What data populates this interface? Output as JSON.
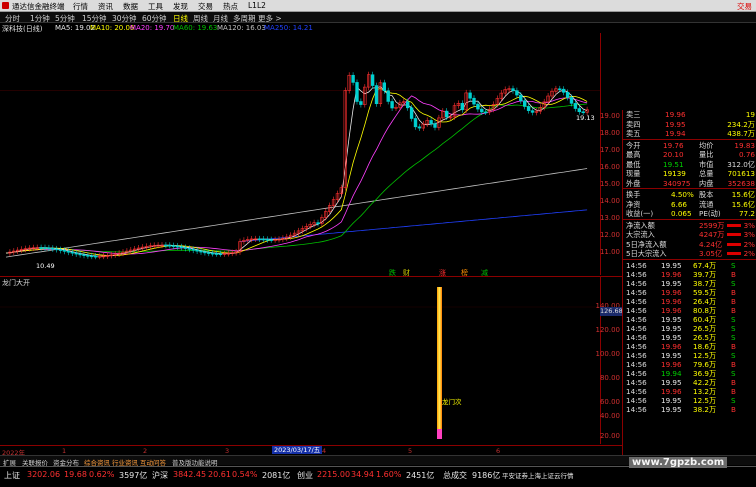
{
  "titlebar": {
    "app": "通达信金融终端",
    "menu": [
      "行情",
      "资讯",
      "数据",
      "工具",
      "发现",
      "交易",
      "热点",
      "L1L2"
    ],
    "right": "交易"
  },
  "toolbar": {
    "periods": [
      "分时",
      "1分钟",
      "5分钟",
      "15分钟",
      "30分钟",
      "60分钟",
      "日线",
      "周线",
      "月线",
      "多周期",
      "更多 >"
    ],
    "active": "日线"
  },
  "infoline": {
    "name": "深科技(日线)",
    "ma5": "MA5: 19.02",
    "ma10": "MA10: 20.06",
    "ma20": "MA20: 19.70",
    "ma60": "MA60: 19.63",
    "ma120": "MA120: 16.03",
    "ma250": "MA250: 14.21"
  },
  "colors": {
    "up": "#ff3030",
    "down": "#00d0d0",
    "ma5": "#e8e8e8",
    "ma10": "#ffff00",
    "ma20": "#ff40ff",
    "ma60": "#00c000",
    "ma120": "#c0c0c0",
    "ma250": "#2040ff"
  },
  "main_axis": [
    "19.00",
    "18.00",
    "17.00",
    "16.00",
    "15.00",
    "14.00",
    "13.00",
    "12.00",
    "11.00"
  ],
  "price_marker": "19.13",
  "low_marker": "10.49",
  "tags": [
    {
      "t": "跌",
      "c": "#00c000"
    },
    {
      "t": "财",
      "c": "#d0d000"
    },
    {
      "t": "涨",
      "c": "#ff3030"
    },
    {
      "t": "榜",
      "c": "#ff9000"
    },
    {
      "t": "减",
      "c": "#00c000"
    }
  ],
  "indicator": {
    "title": "龙门大开",
    "label": "龙门次",
    "value": "126.68",
    "axis": [
      "140.00",
      "120.00",
      "100.00",
      "80.00",
      "60.00",
      "40.00",
      "20.00"
    ]
  },
  "xaxis": {
    "labels": [
      "2022年",
      "1",
      "2",
      "3",
      "4",
      "5",
      "6"
    ],
    "date": "2023/03/17/五"
  },
  "quotes": {
    "ask": [
      {
        "l": "卖三",
        "p": "19.96",
        "v": "19"
      },
      {
        "l": "卖四",
        "p": "19.95",
        "v": "234.2万"
      },
      {
        "l": "卖五",
        "p": "19.94",
        "v": "438.7万"
      }
    ],
    "stats": [
      {
        "a": "今开",
        "b": "19.76",
        "c": "均价",
        "d": "19.83"
      },
      {
        "a": "最高",
        "b": "20.10",
        "c": "量比",
        "d": "0.76"
      },
      {
        "a": "最低",
        "b": "19.51",
        "c": "市值",
        "d": "312.0亿"
      },
      {
        "a": "现量",
        "b": "19139",
        "c": "总量",
        "d": "701613"
      },
      {
        "a": "外盘",
        "b": "340975",
        "c": "内盘",
        "d": "352638"
      }
    ],
    "fund": [
      {
        "a": "换手",
        "b": "4.50%",
        "c": "股本",
        "d": "15.6亿"
      },
      {
        "a": "净资",
        "b": "6.66",
        "c": "流通",
        "d": "15.6亿"
      },
      {
        "a": "收益(一)",
        "b": "0.065",
        "c": "PE(动)",
        "d": "77.2"
      }
    ],
    "flow": [
      {
        "a": "净流入额",
        "b": "2599万",
        "c": "3%"
      },
      {
        "a": "大宗流入",
        "b": "4247万",
        "c": "3%"
      },
      {
        "a": "5日净流入额",
        "b": "4.24亿",
        "c": "2%"
      },
      {
        "a": "5日大宗流入",
        "b": "3.05亿",
        "c": "2%"
      }
    ],
    "ticks": [
      {
        "t": "14:56",
        "p": "19.95",
        "v": "67.4万",
        "s": "S"
      },
      {
        "t": "14:56",
        "p": "19.96",
        "v": "39.7万",
        "s": "B"
      },
      {
        "t": "14:56",
        "p": "19.95",
        "v": "38.7万",
        "s": "S"
      },
      {
        "t": "14:56",
        "p": "19.96",
        "v": "59.5万",
        "s": "B"
      },
      {
        "t": "14:56",
        "p": "19.96",
        "v": "26.4万",
        "s": "B"
      },
      {
        "t": "14:56",
        "p": "19.96",
        "v": "80.8万",
        "s": "B"
      },
      {
        "t": "14:56",
        "p": "19.95",
        "v": "60.4万",
        "s": "S"
      },
      {
        "t": "14:56",
        "p": "19.95",
        "v": "26.5万",
        "s": "S"
      },
      {
        "t": "14:56",
        "p": "19.95",
        "v": "26.5万",
        "s": "S"
      },
      {
        "t": "14:56",
        "p": "19.96",
        "v": "18.6万",
        "s": "B"
      },
      {
        "t": "14:56",
        "p": "19.95",
        "v": "12.5万",
        "s": "S"
      },
      {
        "t": "14:56",
        "p": "19.96",
        "v": "79.6万",
        "s": "B"
      },
      {
        "t": "14:56",
        "p": "19.94",
        "v": "36.9万",
        "s": "S"
      },
      {
        "t": "14:56",
        "p": "19.95",
        "v": "42.2万",
        "s": "B"
      },
      {
        "t": "14:56",
        "p": "19.96",
        "v": "13.2万",
        "s": "B"
      },
      {
        "t": "14:56",
        "p": "19.95",
        "v": "12.5万",
        "s": "S"
      },
      {
        "t": "14:56",
        "p": "19.95",
        "v": "38.2万",
        "s": "B"
      }
    ]
  },
  "bottomtabs": [
    "扩展",
    "关联报价",
    "资金分布",
    "综合资讯",
    "行业资讯",
    "互动问答",
    "普及版功能说明"
  ],
  "status": [
    {
      "n": "上证",
      "v": "3202.06",
      "c": "19.68",
      "p": "0.62%",
      "a": "3597亿"
    },
    {
      "n": "沪深",
      "v": "3842.45",
      "c": "20.61",
      "p": "0.54%",
      "a": "2081亿"
    },
    {
      "n": "创业",
      "v": "2215.00",
      "c": "34.94",
      "p": "1.60%",
      "a": "2451亿"
    }
  ],
  "status_total": {
    "l": "总成交",
    "v": "9186亿"
  },
  "status_right": "平安证券上海上证云行情",
  "watermark": "www.7gpzb.com"
}
